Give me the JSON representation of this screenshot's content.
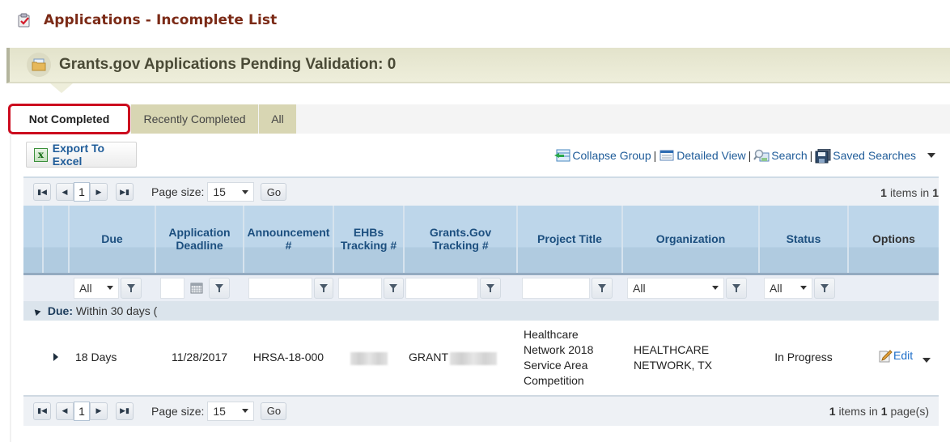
{
  "page": {
    "title": "Applications - Incomplete List",
    "title_icon": "clipboard-check-icon"
  },
  "banner": {
    "text": "Grants.gov Applications Pending Validation: 0",
    "icon": "folder-icon"
  },
  "tabs": [
    {
      "label": "Not Completed",
      "active": true
    },
    {
      "label": "Recently Completed",
      "active": false
    },
    {
      "label": "All",
      "active": false
    }
  ],
  "toolbar": {
    "export_label": "Export To Excel",
    "links": [
      {
        "label": "Collapse Group",
        "icon": "collapse-group-icon"
      },
      {
        "label": "Detailed View",
        "icon": "detailed-view-icon"
      },
      {
        "label": "Search",
        "icon": "search-icon"
      },
      {
        "label": "Saved Searches",
        "icon": "save-disk-icon"
      }
    ]
  },
  "pager_top": {
    "page": "1",
    "page_size_label": "Page size:",
    "page_size": "15",
    "go_label": "Go",
    "items_count": "1",
    "items_text": "items in",
    "pages_count": "1",
    "pages_text": ""
  },
  "pager_bottom": {
    "page": "1",
    "page_size_label": "Page size:",
    "page_size": "15",
    "go_label": "Go",
    "items_count": "1",
    "items_text": "items in",
    "pages_count": "1",
    "pages_text": "page(s)"
  },
  "columns": [
    {
      "key": "expand",
      "label": ""
    },
    {
      "key": "group",
      "label": ""
    },
    {
      "key": "due",
      "label": "Due"
    },
    {
      "key": "deadline",
      "label": "Application Deadline"
    },
    {
      "key": "announcement",
      "label": "Announcement #"
    },
    {
      "key": "ehbs",
      "label": "EHBs Tracking #"
    },
    {
      "key": "grantsgov",
      "label": "Grants.Gov Tracking #"
    },
    {
      "key": "project",
      "label": "Project Title"
    },
    {
      "key": "organization",
      "label": "Organization"
    },
    {
      "key": "status",
      "label": "Status"
    },
    {
      "key": "options",
      "label": "Options"
    }
  ],
  "filters": {
    "due": "All",
    "organization": "All",
    "status": "All"
  },
  "group": {
    "label": "Due:",
    "value": "Within 30 days ("
  },
  "rows": [
    {
      "due": "18 Days",
      "deadline": "11/28/2017",
      "announcement": "HRSA-18-000",
      "ehbs": "",
      "grantsgov_prefix": "GRANT",
      "project": "Healthcare Network 2018 Service Area Competition",
      "organization": "HEALTHCARE NETWORK, TX",
      "status": "In Progress",
      "action": "Edit"
    }
  ],
  "colors": {
    "title": "#7b2a16",
    "link": "#1f5c99",
    "active_tab_outline": "#cc0b1e",
    "header_bg": "#bdd6ea",
    "header_text": "#1c4f7f"
  }
}
